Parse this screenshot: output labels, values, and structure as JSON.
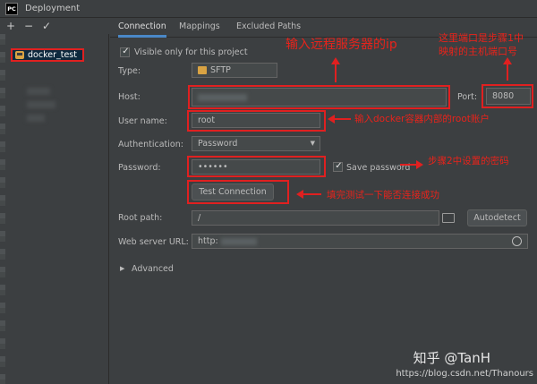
{
  "window": {
    "title": "Deployment",
    "app_icon_text": "PC"
  },
  "toolbar": {
    "add": "+",
    "remove": "−",
    "apply": "✓"
  },
  "sidebar": {
    "selected_server": "docker_test"
  },
  "tabs": [
    {
      "label": "Connection",
      "active": true
    },
    {
      "label": "Mappings",
      "active": false
    },
    {
      "label": "Excluded Paths",
      "active": false
    }
  ],
  "form": {
    "visible_only_label": "Visible only for this project",
    "visible_only_checked": true,
    "type_label": "Type:",
    "type_value": "SFTP",
    "host_label": "Host:",
    "host_value": "",
    "port_label": "Port:",
    "port_value": "8080",
    "user_label": "User name:",
    "user_value": "root",
    "auth_label": "Authentication:",
    "auth_value": "Password",
    "password_label": "Password:",
    "password_value": "••••••",
    "save_password_label": "Save password",
    "save_password_checked": true,
    "test_connection_label": "Test Connection",
    "root_path_label": "Root path:",
    "root_path_value": "/",
    "autodetect_label": "Autodetect",
    "web_server_label": "Web server URL:",
    "web_server_value": "http:",
    "advanced_label": "Advanced"
  },
  "annotations": {
    "host_note": "输入远程服务器的ip",
    "port_note_line1": "这里端口是步骤1中",
    "port_note_line2": "映射的主机端口号",
    "user_note": "输入docker容器内部的root账户",
    "password_note": "步骤2中设置的密码",
    "test_note": "填完测试一下能否连接成功"
  },
  "watermark": {
    "logo_text": "知乎 @TanH",
    "url_text": "https://blog.csdn.net/Thanours"
  },
  "colors": {
    "annotation_red": "#e02020",
    "accent_blue": "#4a88c7",
    "selection_bg": "#0d293e"
  }
}
